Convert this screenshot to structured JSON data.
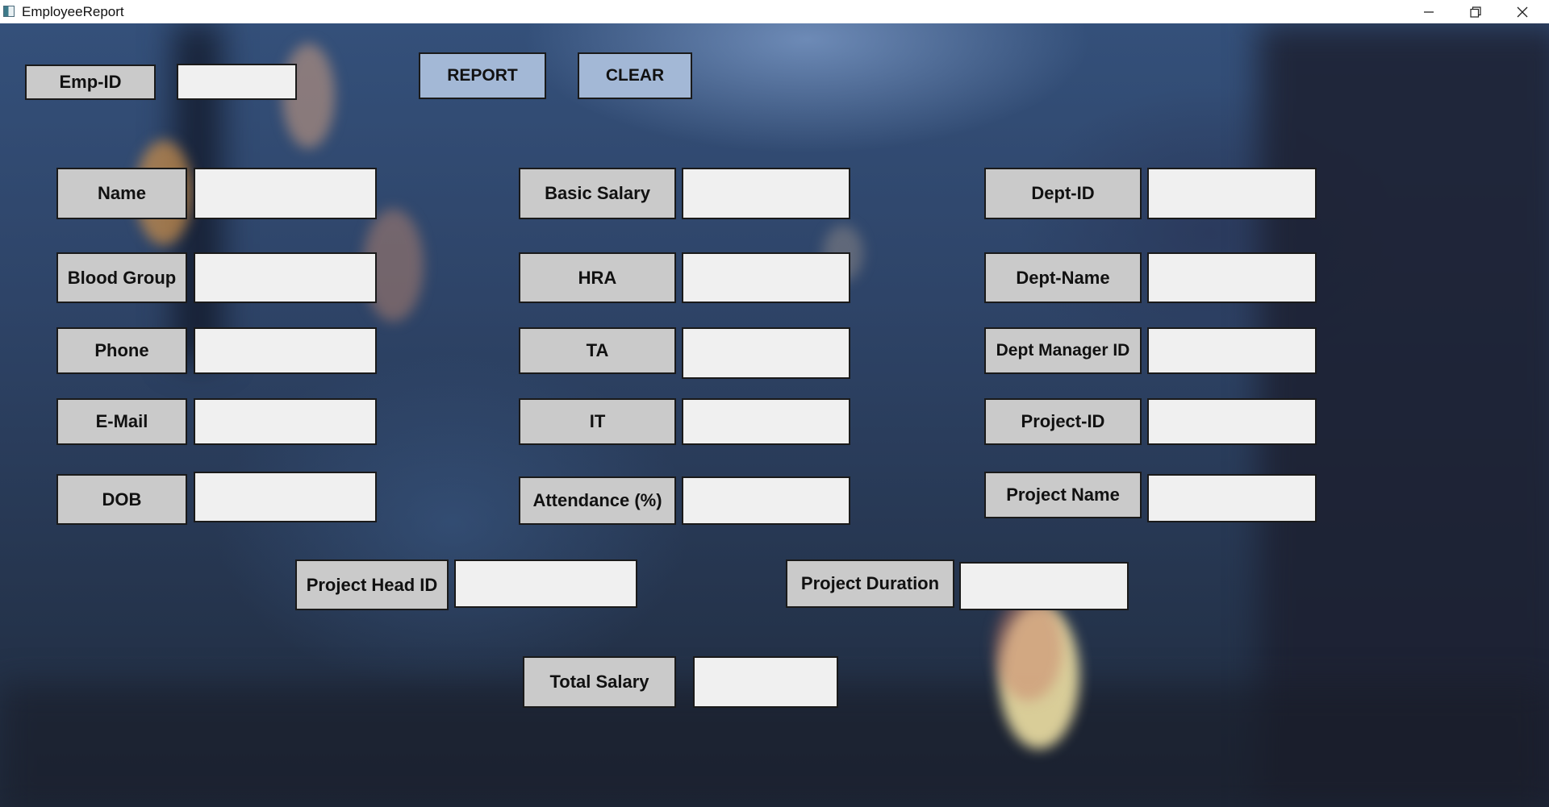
{
  "window": {
    "title": "EmployeeReport"
  },
  "toolbar": {
    "emp_id_label": "Emp-ID",
    "emp_id_value": "",
    "report_button": "REPORT",
    "clear_button": "CLEAR"
  },
  "personal": {
    "name_label": "Name",
    "blood_group_label": "Blood Group",
    "phone_label": "Phone",
    "email_label": "E-Mail",
    "dob_label": "DOB"
  },
  "salary": {
    "basic_salary_label": "Basic Salary",
    "hra_label": "HRA",
    "ta_label": "TA",
    "it_label": "IT",
    "attendance_label": "Attendance (%)"
  },
  "department": {
    "dept_id_label": "Dept-ID",
    "dept_name_label": "Dept-Name",
    "dept_manager_id_label": "Dept Manager ID",
    "project_id_label": "Project-ID",
    "project_name_label": "Project Name"
  },
  "project": {
    "project_head_id_label": "Project Head ID",
    "project_duration_label": "Project Duration"
  },
  "total": {
    "total_salary_label": "Total Salary"
  }
}
